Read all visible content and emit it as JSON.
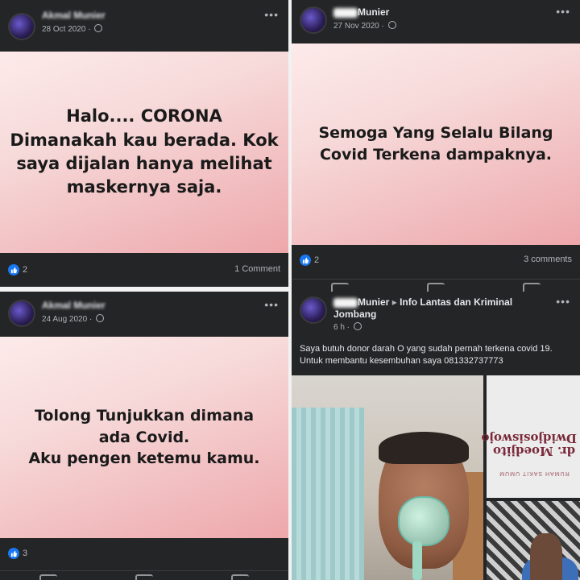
{
  "posts": [
    {
      "author": "Akmal Munier",
      "date": "28 Oct 2020 ·",
      "text": "Halo.... CORONA\nDimanakah kau berada. Kok\nsaya dijalan hanya melihat\nmaskernya saja.",
      "likes": "2",
      "comments": "1 Comment",
      "background_color": "#f3c9cc"
    },
    {
      "author": "Munier",
      "date": "27 Nov 2020 ·",
      "text": "Semoga Yang Selalu Bilang\nCovid Terkena dampaknya.",
      "likes": "2",
      "comments": "3 comments",
      "background_color": "#f3c9cc"
    },
    {
      "author": "Akmal Munier",
      "date": "24 Aug 2020 ·",
      "text": "Tolong Tunjukkan dimana\nada Covid.\nAku pengen ketemu kamu.",
      "likes": "3",
      "background_color": "#f3c9cc"
    },
    {
      "author": "Munier",
      "arrow": "▸",
      "group": "Info Lantas dan Kriminal Jombang",
      "date": "6 h ·",
      "text": "Saya butuh donor darah O yang sudah pernah terkena covid 19.  Untuk membantu kesembuhan saya 081332737773",
      "photo_text": "dr. Moedjito\nDwidjosiswojo",
      "photo_subtext": "RUMAH SAKIT UMUM"
    }
  ],
  "icons": {
    "more": "more-horizontal-icon",
    "privacy": "globe-icon",
    "like": "like-reaction-icon"
  },
  "colors": {
    "card_bg": "#242526",
    "text": "#e4e6eb",
    "muted": "#b0b3b8",
    "like_blue": "#1877f2"
  }
}
